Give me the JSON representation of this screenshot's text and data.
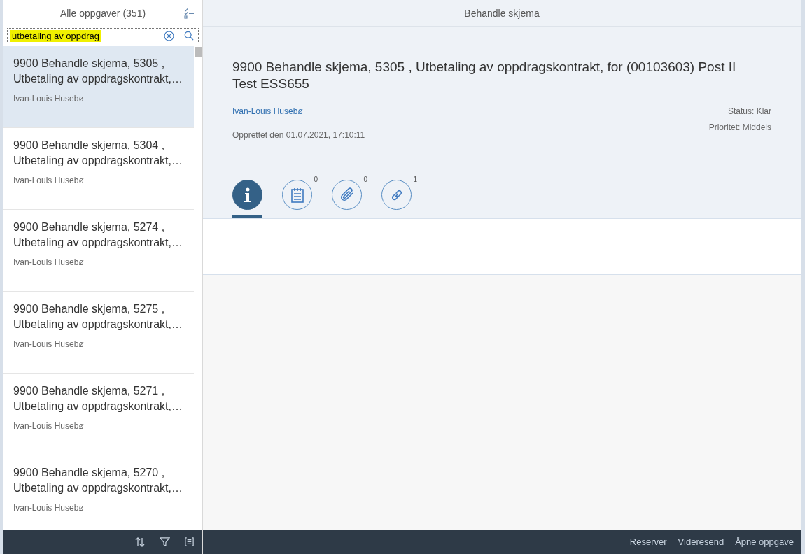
{
  "master": {
    "title": "Alle oppgaver (351)",
    "search": {
      "value": "utbetaling av oppdrag"
    },
    "items": [
      {
        "title": "9900 Behandle skjema, 5305 , Utbetaling av oppdragskontrakt,…",
        "owner": "Ivan-Louis Husebø",
        "selected": true
      },
      {
        "title": "9900 Behandle skjema, 5304 , Utbetaling av oppdragskontrakt,…",
        "owner": "Ivan-Louis Husebø",
        "selected": false
      },
      {
        "title": "9900 Behandle skjema, 5274 , Utbetaling av oppdragskontrakt,…",
        "owner": "Ivan-Louis Husebø",
        "selected": false
      },
      {
        "title": "9900 Behandle skjema, 5275 , Utbetaling av oppdragskontrakt,…",
        "owner": "Ivan-Louis Husebø",
        "selected": false
      },
      {
        "title": "9900 Behandle skjema, 5271 , Utbetaling av oppdragskontrakt,…",
        "owner": "Ivan-Louis Husebø",
        "selected": false
      },
      {
        "title": "9900 Behandle skjema, 5270 , Utbetaling av oppdragskontrakt,…",
        "owner": "Ivan-Louis Husebø",
        "selected": false
      }
    ]
  },
  "detail": {
    "title": "Behandle skjema",
    "heading": "9900 Behandle skjema, 5305 , Utbetaling av oppdragskontrakt, for (00103603) Post II Test ESS655",
    "owner": "Ivan-Louis Husebø",
    "status": "Status: Klar",
    "priority": "Prioritet: Middels",
    "created": "Opprettet den 01.07.2021, 17:10:11",
    "tabs": [
      {
        "kind": "info",
        "selected": true
      },
      {
        "kind": "notes",
        "count": "0",
        "selected": false
      },
      {
        "kind": "attachments",
        "count": "0",
        "selected": false
      },
      {
        "kind": "links",
        "count": "1",
        "selected": false
      }
    ]
  },
  "footer": {
    "buttons": [
      "Reserver",
      "Videresend",
      "Åpne oppgave"
    ]
  }
}
